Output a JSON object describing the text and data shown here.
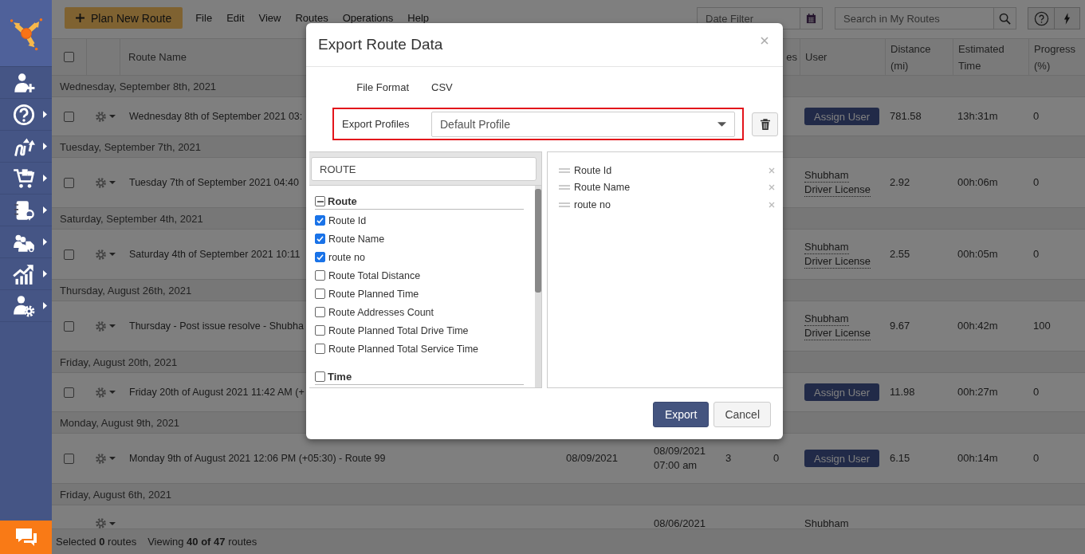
{
  "sidebar": {
    "items": [
      {
        "kind": "add-user",
        "submenu": false
      },
      {
        "kind": "help",
        "submenu": true
      },
      {
        "kind": "routes",
        "submenu": true
      },
      {
        "kind": "cart",
        "submenu": true
      },
      {
        "kind": "address-book",
        "submenu": true
      },
      {
        "kind": "team",
        "submenu": true
      },
      {
        "kind": "analytics",
        "submenu": true
      },
      {
        "kind": "user-settings",
        "submenu": true
      }
    ]
  },
  "toolbar": {
    "primary_button": "Plan New Route",
    "menu": [
      "File",
      "Edit",
      "View",
      "Routes",
      "Operations",
      "Help"
    ],
    "date_filter": {
      "placeholder": "Date Filter"
    },
    "search": {
      "placeholder": "Search in My Routes"
    }
  },
  "table": {
    "header": {
      "select_all": {
        "checked": false
      },
      "route_name": "Route Name",
      "column_7": "es",
      "user": "User",
      "distance": "Distance (mi)",
      "estimated_time": "Estimated Time",
      "progress": "Progress (%)"
    },
    "groups": [
      {
        "label": "Wednesday, September 8th, 2021",
        "rows": [
          {
            "checked": false,
            "route_name": "Wednesday 8th of September 2021 03:",
            "user": {
              "kind": "assign",
              "label": "Assign User"
            },
            "distance": "781.58",
            "estimated_time": "13h:31m",
            "progress": "0"
          }
        ]
      },
      {
        "label": "Tuesday, September 7th, 2021",
        "rows": [
          {
            "checked": false,
            "route_name": "Tuesday 7th of September 2021 04:40",
            "user": {
              "kind": "link",
              "lines": [
                "Shubham",
                "Driver License"
              ]
            },
            "distance": "2.92",
            "estimated_time": "00h:06m",
            "progress": "0"
          }
        ]
      },
      {
        "label": "Saturday, September 4th, 2021",
        "rows": [
          {
            "checked": false,
            "route_name": "Saturday 4th of September 2021 10:11",
            "user": {
              "kind": "link",
              "lines": [
                "Shubham",
                "Driver License"
              ]
            },
            "distance": "2.55",
            "estimated_time": "00h:05m",
            "progress": "0"
          }
        ]
      },
      {
        "label": "Thursday, August 26th, 2021",
        "rows": [
          {
            "checked": false,
            "route_name": "Thursday - Post issue resolve - Shubha",
            "user": {
              "kind": "link",
              "lines": [
                "Shubham",
                "Driver License"
              ]
            },
            "distance": "9.67",
            "estimated_time": "00h:42m",
            "progress": "100"
          }
        ]
      },
      {
        "label": "Friday, August 20th, 2021",
        "rows": [
          {
            "checked": false,
            "route_name": "Friday 20th of August 2021 11:42 AM (+",
            "user": {
              "kind": "assign",
              "label": "Assign User"
            },
            "distance": "11.98",
            "estimated_time": "00h:27m",
            "progress": "0"
          }
        ]
      },
      {
        "label": "Monday, August 9th, 2021",
        "rows": [
          {
            "checked": false,
            "route_name": "Monday 9th of August 2021 12:06 PM (+05:30) - Route 99",
            "date": "08/09/2021",
            "scheduled": [
              "08/09/2021",
              "07:00 am"
            ],
            "stops": "3",
            "column_7": "0",
            "user": {
              "kind": "assign",
              "label": "Assign User"
            },
            "distance": "6.15",
            "estimated_time": "00h:14m",
            "progress": "0"
          }
        ]
      },
      {
        "label": "Friday, August 6th, 2021",
        "rows": [
          {
            "scheduled": [
              "08/06/2021"
            ],
            "user": {
              "kind": "link",
              "lines": [
                "Shubham"
              ]
            }
          }
        ]
      }
    ]
  },
  "status_bar": {
    "selected": "Selected **0** routes",
    "viewing": "Viewing **40 of 47** routes"
  },
  "dialog": {
    "title": "Export Route Data",
    "file_format": {
      "label": "File Format",
      "value": "CSV"
    },
    "export_profiles": {
      "label": "Export Profiles",
      "value": "Default Profile",
      "highlighted": true
    },
    "field_search": {
      "value": "ROUTE"
    },
    "field_groups": [
      {
        "label": "Route",
        "partial": true,
        "fields": [
          {
            "label": "Route Id",
            "checked": true
          },
          {
            "label": "Route Name",
            "checked": true
          },
          {
            "label": "route no",
            "checked": true
          },
          {
            "label": "Route Total Distance",
            "checked": false
          },
          {
            "label": "Route Planned Time",
            "checked": false
          },
          {
            "label": "Route Addresses Count",
            "checked": false
          },
          {
            "label": "Route Planned Total Drive Time",
            "checked": false
          },
          {
            "label": "Route Planned Total Service Time",
            "checked": false
          }
        ]
      },
      {
        "label": "Time",
        "partial": false
      }
    ],
    "selected_fields": [
      "Route Id",
      "Route Name",
      "route no"
    ],
    "buttons": [
      {
        "label": "Export",
        "kind": "primary"
      },
      {
        "label": "Cancel",
        "kind": "secondary"
      }
    ]
  }
}
